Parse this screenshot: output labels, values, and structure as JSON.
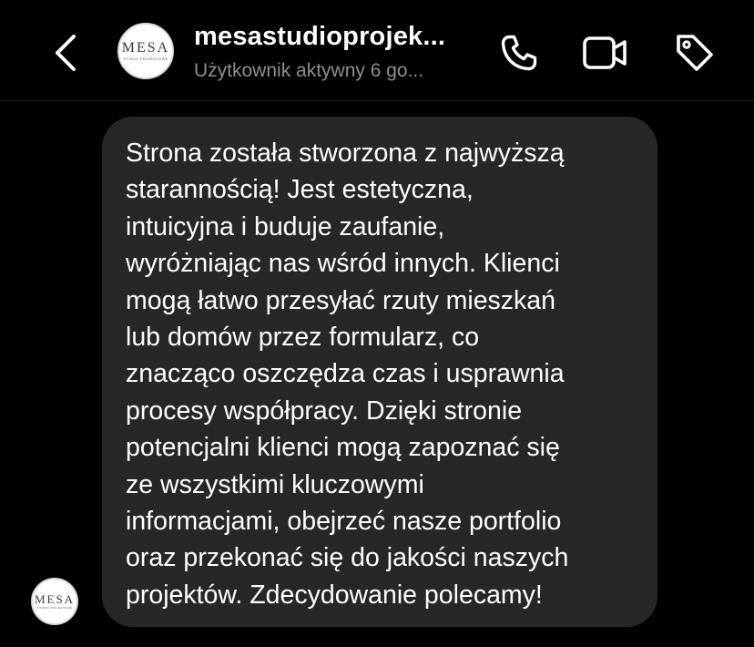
{
  "header": {
    "back_icon": "chevron-left-icon",
    "contact_name": "mesastudioprojek...",
    "status": "Użytkownik aktywny 6 go...",
    "avatar": {
      "word": "MESA",
      "subtitle": "STUDIO PROJEKTOWE"
    },
    "actions": {
      "call_icon": "phone-icon",
      "video_icon": "video-camera-icon",
      "tag_icon": "tag-icon"
    }
  },
  "thread": {
    "messages": [
      {
        "sender_avatar": {
          "word": "MESA",
          "subtitle": "STUDIO PROJEKTOWE"
        },
        "text": "Strona została stworzona z najwyższą\nstarannością! Jest estetyczna,\nintuicyjna i buduje zaufanie,\nwyróżniając nas wśród innych. Klienci\nmogą łatwo przesyłać rzuty mieszkań\nlub domów przez formularz, co\nznacząco oszczędza czas i usprawnia\nprocesy współpracy. Dzięki stronie\npotencjalni klienci mogą zapoznać się\nze wszystkimi kluczowymi\ninformacjami, obejrzeć nasze portfolio\noraz przekonać się do jakości naszych\nprojektów. Zdecydowanie polecamy!"
      }
    ]
  },
  "colors": {
    "background": "#000000",
    "bubble": "#262729",
    "primary_text": "#ffffff",
    "secondary_text": "#8e8e8e"
  }
}
